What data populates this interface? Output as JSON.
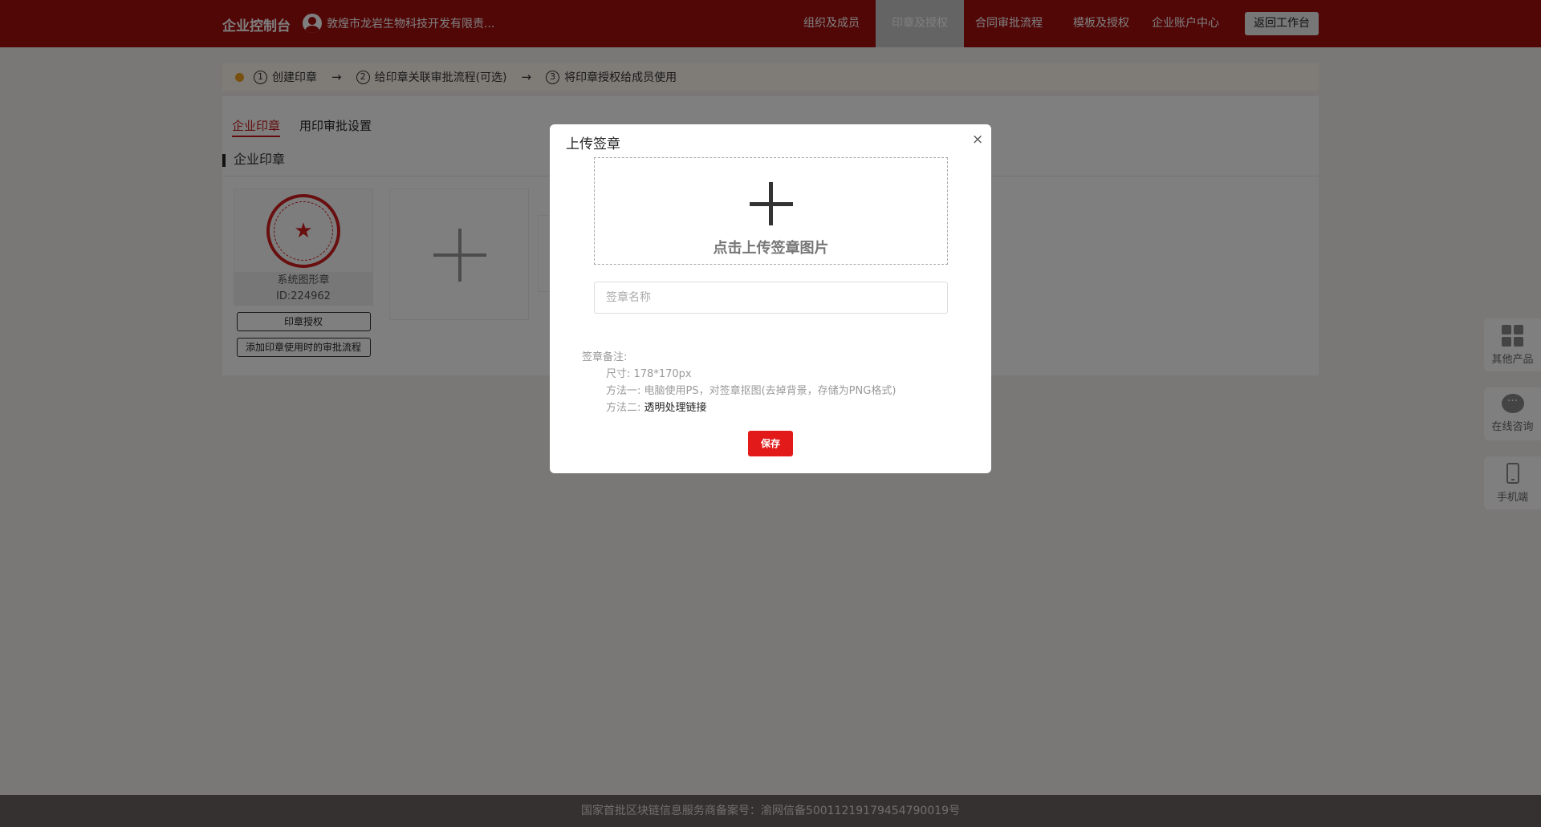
{
  "header": {
    "brand": "企业控制台",
    "company_name": "敦煌市龙岩生物科技开发有限责...",
    "nav": [
      "组织及成员",
      "印章及授权",
      "合同审批流程",
      "模板及授权",
      "企业账户中心"
    ],
    "active_nav": "印章及授权",
    "back_button": "返回工作台"
  },
  "steps": {
    "items": [
      {
        "num": "1",
        "label": "创建印章"
      },
      {
        "num": "2",
        "label": "给印章关联审批流程(可选)"
      },
      {
        "num": "3",
        "label": "将印章授权给成员使用"
      }
    ],
    "arrow": "→"
  },
  "tabs": [
    "企业印章",
    "用印审批设置"
  ],
  "section_title": "企业印章",
  "seal_card": {
    "name": "系统图形章",
    "id": "ID:224962",
    "authorize_button": "印章授权",
    "add_flow_button": "添加印章使用时的审批流程"
  },
  "modal": {
    "title": "上传签章",
    "close": "×",
    "upload_text": "点击上传签章图片",
    "name_placeholder": "签章名称",
    "notes_title": "签章备注:",
    "note_size": "尺寸: 178*170px",
    "note_method1": "方法一: 电脑使用PS，对签章抠图(去掉背景，存储为PNG格式)",
    "note_method2_prefix": "方法二: ",
    "note_method2_link": "透明处理链接",
    "save_button": "保存"
  },
  "side_widgets": [
    "其他产品",
    "在线咨询",
    "手机端"
  ],
  "footer": "国家首批区块链信息服务商备案号：渝网信备50011219179454790019号",
  "colors": {
    "header_bg": "#a50f0f",
    "accent_red": "#e21a1a",
    "tab_active": "#c81818"
  }
}
